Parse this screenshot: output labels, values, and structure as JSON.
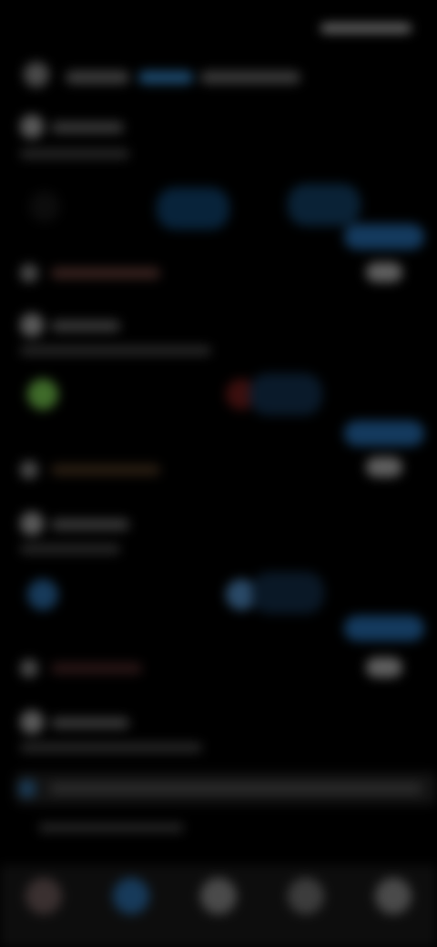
{
  "status_bar": {
    "time": ""
  },
  "source_row": {
    "label": ""
  },
  "feed": {
    "cards": [
      {
        "title": "",
        "subtitle": "",
        "footer": ""
      },
      {
        "title": "",
        "subtitle": "",
        "footer": ""
      },
      {
        "title": "",
        "subtitle": "",
        "footer": ""
      },
      {
        "title": "",
        "subtitle": ""
      }
    ]
  },
  "composer": {
    "placeholder": ""
  },
  "bottom_nav": {
    "items": [
      {
        "label": "",
        "icon": "avatar-icon"
      },
      {
        "label": "",
        "icon": "search-icon"
      },
      {
        "label": "",
        "icon": "home-icon"
      },
      {
        "label": "",
        "icon": "bell-icon"
      },
      {
        "label": "",
        "icon": "menu-icon"
      }
    ]
  },
  "colors": {
    "background": "#000000",
    "accent": "#1d4a6e",
    "status_green": "#4caf50",
    "status_red": "#b0302b",
    "status_orange": "#c87a1a"
  }
}
